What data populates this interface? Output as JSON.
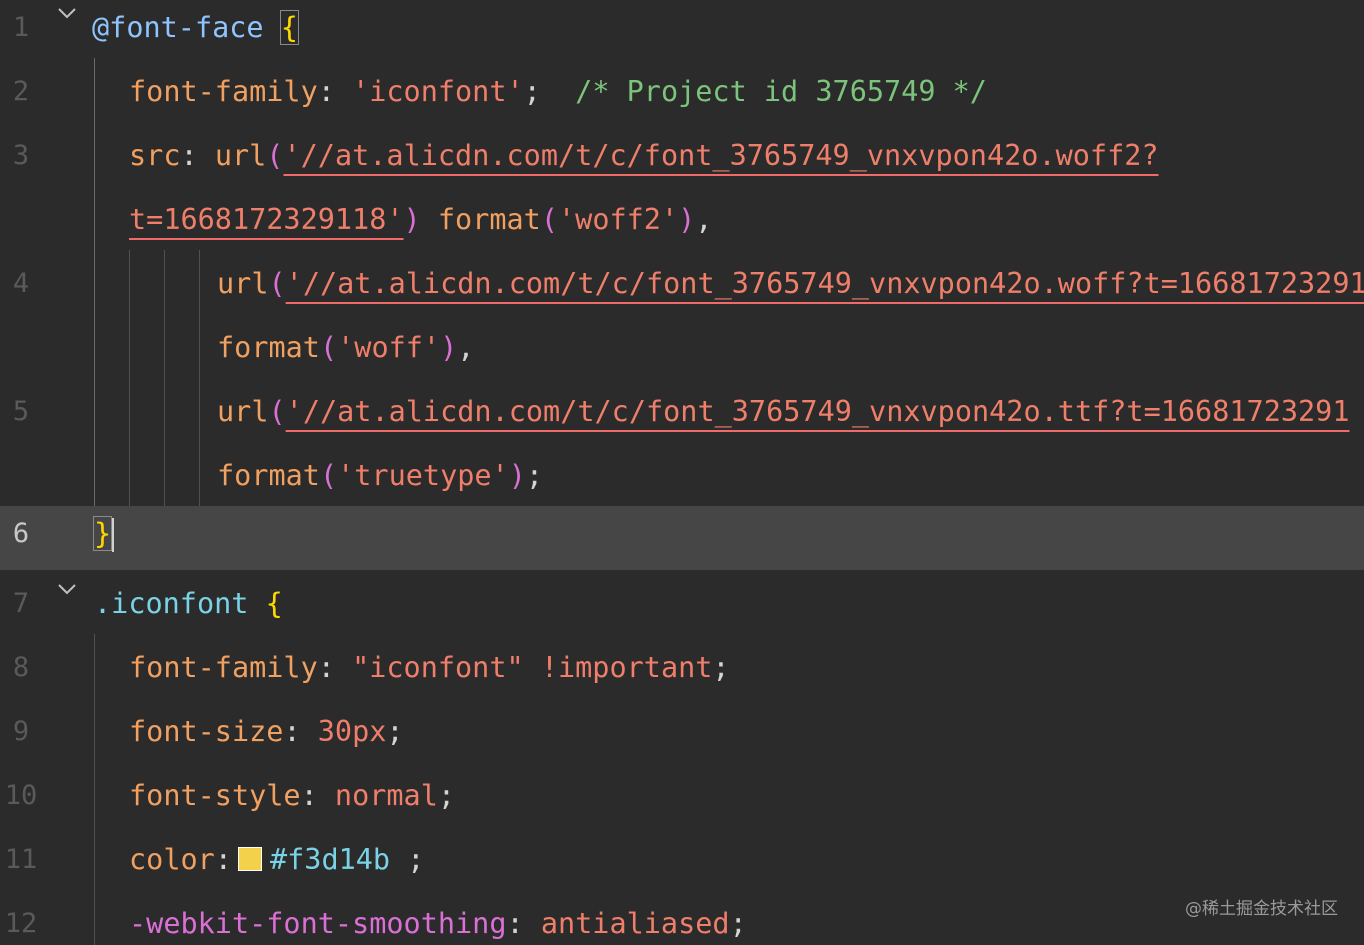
{
  "editor": {
    "active_line": "6",
    "watermark": "@稀土掘金技术社区"
  },
  "colors": {
    "background": "#2b2b2b",
    "active_line": "#464646",
    "swatch": "#f3d14b"
  },
  "icons": [
    "chevron-down-icon",
    "color-swatch-icon"
  ],
  "lines": [
    {
      "number": "1",
      "tokens": [
        "@font-face",
        " ",
        "{"
      ]
    },
    {
      "number": "2",
      "tokens": [
        "font-family",
        ": ",
        "'iconfont'",
        ";",
        "  /* Project id 3765749 */"
      ]
    },
    {
      "number": "3",
      "tokens": [
        "src",
        ": ",
        "url",
        "(",
        "'//at.alicdn.com/t/c/font_3765749_vnxvpon42o.woff2?"
      ]
    },
    {
      "number": "",
      "tokens": [
        "t=1668172329118'",
        ")",
        " ",
        "format",
        "(",
        "'woff2'",
        ")",
        ","
      ]
    },
    {
      "number": "4",
      "tokens": [
        "url",
        "(",
        "'//at.alicdn.com/t/c/font_3765749_vnxvpon42o.woff?t=16681723291"
      ]
    },
    {
      "number": "",
      "tokens": [
        "format",
        "(",
        "'woff'",
        ")",
        ","
      ]
    },
    {
      "number": "5",
      "tokens": [
        "url",
        "(",
        "'//at.alicdn.com/t/c/font_3765749_vnxvpon42o.ttf?t=16681723291"
      ]
    },
    {
      "number": "",
      "tokens": [
        "format",
        "(",
        "'truetype'",
        ")",
        ";"
      ]
    },
    {
      "number": "6",
      "tokens": [
        "}"
      ]
    },
    {
      "number": "7",
      "tokens": [
        ".iconfont",
        " ",
        "{"
      ]
    },
    {
      "number": "8",
      "tokens": [
        "font-family",
        ": ",
        "\"iconfont\"",
        " !important",
        ";"
      ]
    },
    {
      "number": "9",
      "tokens": [
        "font-size",
        ": ",
        "30px",
        ";"
      ]
    },
    {
      "number": "10",
      "tokens": [
        "font-style",
        ": ",
        "normal",
        ";"
      ]
    },
    {
      "number": "11",
      "tokens": [
        "color",
        ":",
        "#f3d14b",
        " ;"
      ]
    },
    {
      "number": "12",
      "tokens": [
        "-webkit-font-smoothing",
        ": ",
        "antialiased",
        ";"
      ]
    }
  ]
}
